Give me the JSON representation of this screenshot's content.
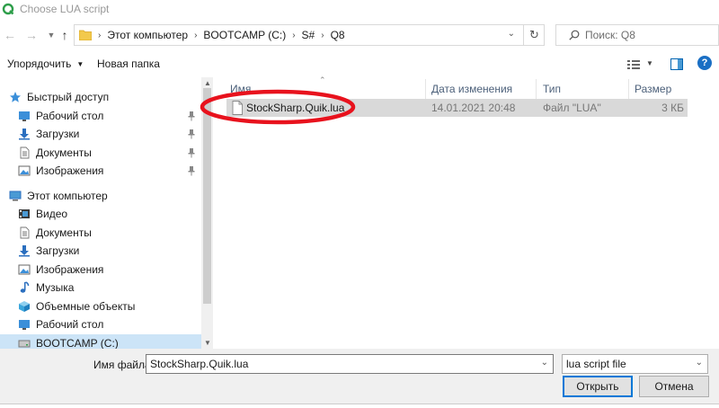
{
  "window": {
    "title": "Choose LUA script"
  },
  "address": {
    "crumbs": [
      "Этот компьютер",
      "BOOTCAMP (C:)",
      "S#",
      "Q8"
    ]
  },
  "search": {
    "placeholder": "Поиск: Q8"
  },
  "toolbar": {
    "organize": "Упорядочить",
    "new_folder": "Новая папка"
  },
  "sidebar": {
    "quick_access": "Быстрый доступ",
    "quick_items": [
      "Рабочий стол",
      "Загрузки",
      "Документы",
      "Изображения"
    ],
    "this_pc": "Этот компьютер",
    "pc_items": [
      "Видео",
      "Документы",
      "Загрузки",
      "Изображения",
      "Музыка",
      "Объемные объекты",
      "Рабочий стол",
      "BOOTCAMP (C:)"
    ]
  },
  "columns": {
    "name": "Имя",
    "date": "Дата изменения",
    "type": "Тип",
    "size": "Размер"
  },
  "files": [
    {
      "name": "StockSharp.Quik.lua",
      "date": "14.01.2021 20:48",
      "type": "Файл \"LUA\"",
      "size": "3 КБ"
    }
  ],
  "footer": {
    "file_name_label": "Имя файла:",
    "file_name_value": "StockSharp.Quik.lua",
    "file_type": "lua script file",
    "open_button": "Открыть",
    "cancel_button": "Отмена"
  },
  "colors": {
    "accent": "#0078d7",
    "selection": "#cce4f7",
    "annotation": "#e8121d"
  }
}
